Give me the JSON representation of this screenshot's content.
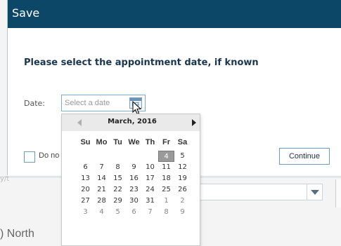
{
  "dialog": {
    "title": "Save",
    "prompt": "Please select the appointment date, if known",
    "date_label": "Date:",
    "date_placeholder": "Select a date",
    "checkbox_label": "Do no",
    "continue_label": "Continue"
  },
  "background": {
    "frag_label": "y/t",
    "north_text": ") North"
  },
  "datepicker": {
    "month": "March, 2016",
    "weekdays": [
      "Su",
      "Mo",
      "Tu",
      "We",
      "Th",
      "Fr",
      "Sa"
    ],
    "selected_day": "4",
    "weeks": [
      [
        {
          "d": "",
          "o": false
        },
        {
          "d": "",
          "o": false
        },
        {
          "d": "",
          "o": false
        },
        {
          "d": "",
          "o": false
        },
        {
          "d": "",
          "o": false
        },
        {
          "d": "4",
          "o": false,
          "s": true
        },
        {
          "d": "5",
          "o": false
        }
      ],
      [
        {
          "d": "6",
          "o": false
        },
        {
          "d": "7",
          "o": false
        },
        {
          "d": "8",
          "o": false
        },
        {
          "d": "9",
          "o": false
        },
        {
          "d": "10",
          "o": false
        },
        {
          "d": "11",
          "o": false
        },
        {
          "d": "12",
          "o": false
        }
      ],
      [
        {
          "d": "13",
          "o": false
        },
        {
          "d": "14",
          "o": false
        },
        {
          "d": "15",
          "o": false
        },
        {
          "d": "16",
          "o": false
        },
        {
          "d": "17",
          "o": false
        },
        {
          "d": "18",
          "o": false
        },
        {
          "d": "19",
          "o": false
        }
      ],
      [
        {
          "d": "20",
          "o": false
        },
        {
          "d": "21",
          "o": false
        },
        {
          "d": "22",
          "o": false
        },
        {
          "d": "23",
          "o": false
        },
        {
          "d": "24",
          "o": false
        },
        {
          "d": "25",
          "o": false
        },
        {
          "d": "26",
          "o": false
        }
      ],
      [
        {
          "d": "27",
          "o": false
        },
        {
          "d": "28",
          "o": false
        },
        {
          "d": "29",
          "o": false
        },
        {
          "d": "30",
          "o": false
        },
        {
          "d": "31",
          "o": false
        },
        {
          "d": "1",
          "o": true
        },
        {
          "d": "2",
          "o": true
        }
      ],
      [
        {
          "d": "3",
          "o": true
        },
        {
          "d": "4",
          "o": true
        },
        {
          "d": "5",
          "o": true
        },
        {
          "d": "6",
          "o": true
        },
        {
          "d": "7",
          "o": true
        },
        {
          "d": "8",
          "o": true
        },
        {
          "d": "9",
          "o": true
        }
      ]
    ]
  },
  "colors": {
    "header_bg": "#0c4767",
    "accent_border": "#6a9bc1",
    "selected_day_bg": "#9a9a9a"
  },
  "icons": {
    "calendar": "calendar-icon",
    "cursor": "mouse-pointer-icon",
    "prev": "chevron-left-icon",
    "next": "chevron-right-icon",
    "dropdown": "chevron-down-icon"
  }
}
